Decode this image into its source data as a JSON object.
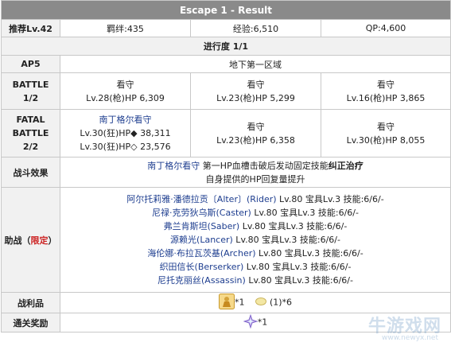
{
  "title": "Escape 1 - Result",
  "stats": {
    "recommended_level": "推荐Lv.42",
    "bond": "羁绊:435",
    "exp": "经验:6,510",
    "qp": "QP:4,600"
  },
  "progress": "进行度 1/1",
  "ap": {
    "label": "AP5",
    "location": "地下第一区域"
  },
  "battle1": {
    "label": "BATTLE\n1/2",
    "enemies": [
      {
        "name": "看守",
        "info": "Lv.28(枪)HP 6,309"
      },
      {
        "name": "看守",
        "info": "Lv.23(枪)HP 5,299"
      },
      {
        "name": "看守",
        "info": "Lv.16(枪)HP 3,865"
      }
    ]
  },
  "battle2": {
    "label_line1": "FATAL",
    "label_line2": "BATTLE",
    "label_line3": "2/2",
    "boss_name": "南丁格尔看守",
    "boss_hp1": "Lv.30(狂)HP◆ 38,311",
    "boss_hp2": "Lv.30(狂)HP◇ 23,576",
    "enemies": [
      {
        "name": "看守",
        "info": "Lv.23(枪)HP 6,358"
      },
      {
        "name": "看守",
        "info": "Lv.30(枪)HP 8,055"
      }
    ]
  },
  "battle_effect": {
    "label": "战斗效果",
    "line1_name": "南丁格尔看守",
    "line1_rest": " 第一HP血槽击破后发动固定技能",
    "line1_skill": "纠正治疗",
    "line2": "自身提供的HP回复量提升"
  },
  "support": {
    "label": "助战（",
    "label_red": "限定",
    "label_end": "）",
    "servants": [
      {
        "name": "阿尔托莉雅·潘德拉贡〔Alter〕(Rider)",
        "detail": " Lv.80 宝具Lv.3 技能:6/6/-"
      },
      {
        "name": "尼禄·克劳狄乌斯(Caster)",
        "detail": " Lv.80 宝具Lv.3 技能:6/6/-"
      },
      {
        "name": "弗兰肯斯坦(Saber)",
        "detail": " Lv.80 宝具Lv.3 技能:6/6/-"
      },
      {
        "name": "源赖光(Lancer)",
        "detail": " Lv.80 宝具Lv.3 技能:6/6/-"
      },
      {
        "name": "海伦娜·布拉瓦茨基(Archer)",
        "detail": " Lv.80 宝具Lv.3 技能:6/6/-"
      },
      {
        "name": "织田信长(Berserker)",
        "detail": " Lv.80 宝具Lv.3 技能:6/6/-"
      },
      {
        "name": "尼托克丽丝(Assassin)",
        "detail": " Lv.80 宝具Lv.3 技能:6/6/-"
      }
    ]
  },
  "loot": {
    "label": "战利品",
    "item1_count": "*1",
    "item2_count": "(1)*6"
  },
  "clear_reward": {
    "label": "通关奖励",
    "count": "*1"
  },
  "watermark": {
    "text": "牛游戏网",
    "url": "www.newyx.net"
  },
  "colors": {
    "header_bg": "#8a8a8a",
    "label_bg": "#f1f1f1",
    "link": "#1d3d8f",
    "accent_red": "#cc2222"
  }
}
